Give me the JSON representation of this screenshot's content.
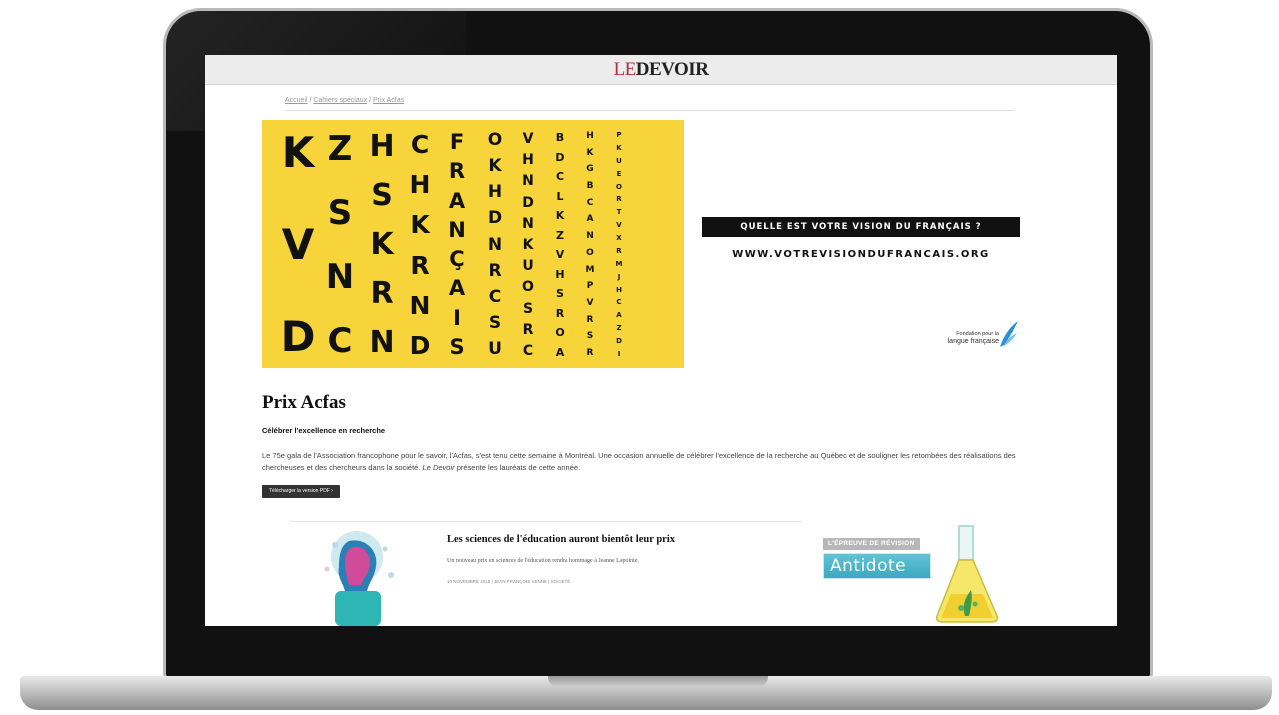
{
  "site": {
    "logo_prefix": "LE",
    "logo_main": "DEVOIR"
  },
  "breadcrumb": [
    "Accueil",
    "Cahiers spéciaux",
    "Prix Acfas"
  ],
  "banner": {
    "word_columns": [
      "KVD",
      "ZSNC",
      "HSKRN",
      "CHKRND",
      "FRANÇAIS",
      "OKHDNRCSU",
      "VHNDNKUOSRC",
      "BDCLKZVHSROA",
      "HKGBCANOMPVRSR",
      "PKUEORTVXRMJHCAZDI"
    ],
    "vision_label": "QUELLE EST VOTRE VISION DU FRANÇAIS ?",
    "vision_url": "WWW.VOTREVISIONDUFRANCAIS.ORG",
    "sponsor_line1": "Fondation pour la",
    "sponsor_line2": "langue française"
  },
  "article": {
    "title": "Prix Acfas",
    "subtitle": "Célébrer l'excellence en recherche",
    "intro_part1": "Le 75e gala de l'Association francophone pour le savoir, l'Acfas, s'est tenu cette semaine à Montréal. Une occasion annuelle de célébrer l'excellence de la recherche au Québec et de souligner les retombées des réalisations des chercheuses et des chercheurs dans la société. ",
    "intro_em": "Le Devoir",
    "intro_part2": " présente les lauréats de cette année.",
    "pdf_button": "Télécharger la version PDF"
  },
  "teaser": {
    "title": "Les sciences de l'éducation auront bientôt leur prix",
    "description": "Un nouveau prix en sciences de l'éducation rendra hommage à Jeanne Lapointe.",
    "meta": "10 NOVEMBRE 2018 | JEAN-FRANÇOIS VENNE | SOCIÉTÉ"
  },
  "ad": {
    "ribbon": "L'ÉPREUVE DE RÉVISION",
    "brand": "Antidote"
  },
  "colors": {
    "banner_yellow": "#f6d43a",
    "logo_accent": "#b3313c",
    "ad_cyan": "#3ea8bf"
  }
}
